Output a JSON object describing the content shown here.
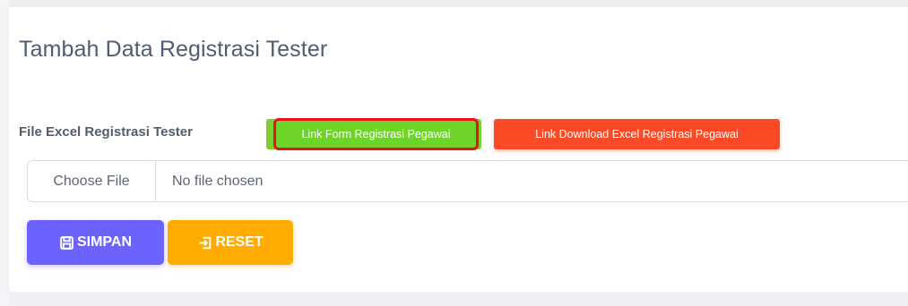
{
  "page": {
    "title": "Tambah Data Registrasi Tester"
  },
  "form": {
    "file_label": "File Excel Registrasi Tester",
    "link_form_button": "Link Form Registrasi Pegawai",
    "link_download_button": "Link Download Excel Registrasi Pegawai",
    "file_input": {
      "choose_label": "Choose File",
      "status": "No file chosen"
    },
    "save_button": "SIMPAN",
    "reset_button": "RESET"
  },
  "icons": {
    "save": "floppy-disk-icon",
    "reset": "sign-in-arrow-icon"
  },
  "colors": {
    "link_form_bg": "#6fd42a",
    "link_form_highlight_border": "#e3121b",
    "link_download_bg": "#fb4a26",
    "save_bg": "#6c63ff",
    "reset_bg": "#ffab00",
    "title_text": "#4f5d73"
  }
}
